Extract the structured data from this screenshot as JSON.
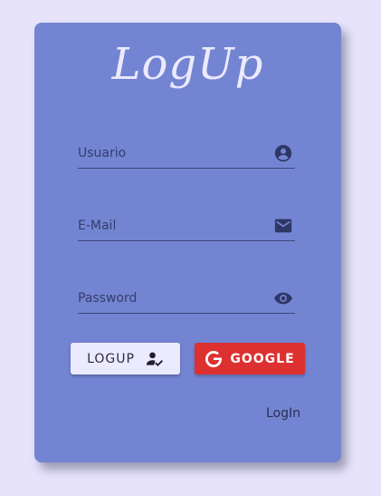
{
  "form": {
    "title": "LogUp",
    "fields": [
      {
        "placeholder": "Usuario",
        "value": "",
        "icon": "account-circle-icon"
      },
      {
        "placeholder": "E-Mail",
        "value": "",
        "icon": "email-icon"
      },
      {
        "placeholder": "Password",
        "value": "",
        "icon": "eye-icon"
      }
    ],
    "logup_button_label": "LOGUP",
    "google_button_label": "GOOGLE",
    "login_link_label": "LogIn"
  },
  "colors": {
    "page_background": "#e6e3fb",
    "card_background": "#7385d2",
    "title_text": "#eceaff",
    "icon_color": "#2f3766",
    "logup_button_bg": "#eceaff",
    "google_button_bg": "#dd3131"
  }
}
